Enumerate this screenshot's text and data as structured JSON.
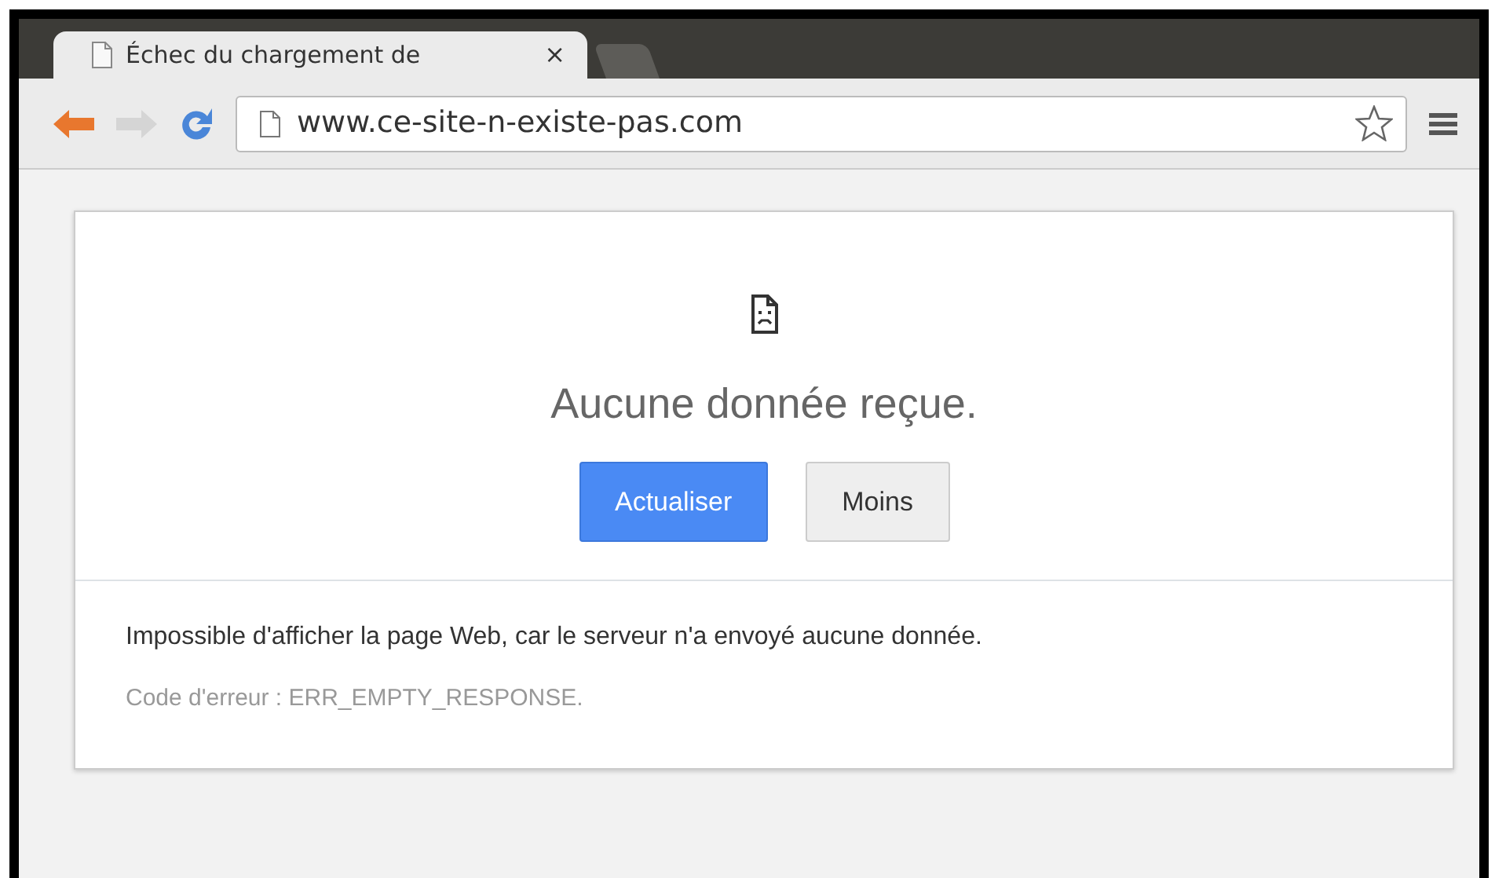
{
  "tabs": [
    {
      "title": "Échec du chargement de",
      "close": "×",
      "selected": true
    }
  ],
  "address_bar": {
    "url": "www.ce-site-n-existe-pas.com",
    "bookmarked": false
  },
  "error": {
    "title": "Aucune donnée reçue.",
    "buttons": [
      {
        "label": "Actualiser",
        "kind": "primary"
      },
      {
        "label": "Moins",
        "kind": "secondary"
      }
    ],
    "message": "Impossible d'afficher la page Web, car le serveur n'a envoyé aucune donnée.",
    "code": "Code d'erreur : ERR_EMPTY_RESPONSE."
  }
}
